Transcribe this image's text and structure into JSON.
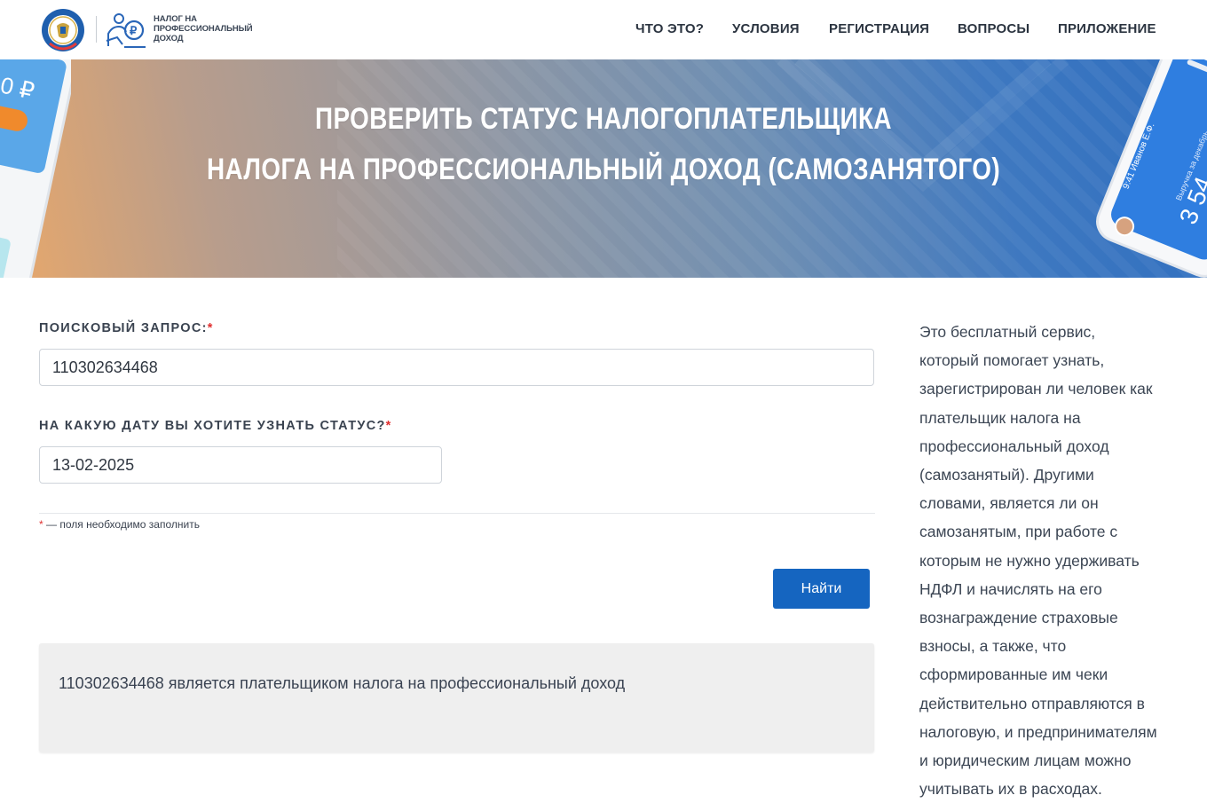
{
  "header": {
    "logo_text_lines": [
      "НАЛОГ НА",
      "ПРОФЕССИОНАЛЬНЫЙ",
      "ДОХОД"
    ],
    "nav": [
      "ЧТО ЭТО?",
      "УСЛОВИЯ",
      "РЕГИСТРАЦИЯ",
      "ВОПРОСЫ",
      "ПРИЛОЖЕНИЕ"
    ]
  },
  "banner": {
    "title_line1": "ПРОВЕРИТЬ СТАТУС НАЛОГОПЛАТЕЛЬЩИКА",
    "title_line2": "НАЛОГА НА ПРОФЕССИОНАЛЬНЫЙ ДОХОД (САМОЗАНЯТОГО)"
  },
  "form": {
    "query_label": "ПОИСКОВЫЙ ЗАПРОС:",
    "query_value": "110302634468",
    "date_label": "НА КАКУЮ ДАТУ ВЫ ХОТИТЕ УЗНАТЬ СТАТУС?",
    "date_value": "13-02-2025",
    "required_mark": "*",
    "required_note": "— поля необходимо заполнить",
    "submit_label": "Найти"
  },
  "result": {
    "text": "110302634468 является плательщиком налога на профессиональный доход"
  },
  "sidebar": {
    "lines": [
      "Это бесплатный сервис,",
      "который помогает узнать,",
      "зарегистрирован ли человек как",
      "плательщик налога на",
      "профессиональный доход",
      "(самозанятый). Другими",
      "словами, является ли он",
      "самозанятым, при работе с",
      "которым не нужно удерживать",
      "НДФЛ и начислять на его",
      "вознаграждение страховые",
      "взносы, а также, что",
      "сформированные им чеки",
      "действительно отправляются в",
      "налоговую, и предпринимателям",
      "и юридическим лицам можно",
      "учитывать их в расходах."
    ]
  },
  "colors": {
    "primary_button": "#1565c0",
    "required": "#e03030",
    "result_bg": "#efefef"
  }
}
